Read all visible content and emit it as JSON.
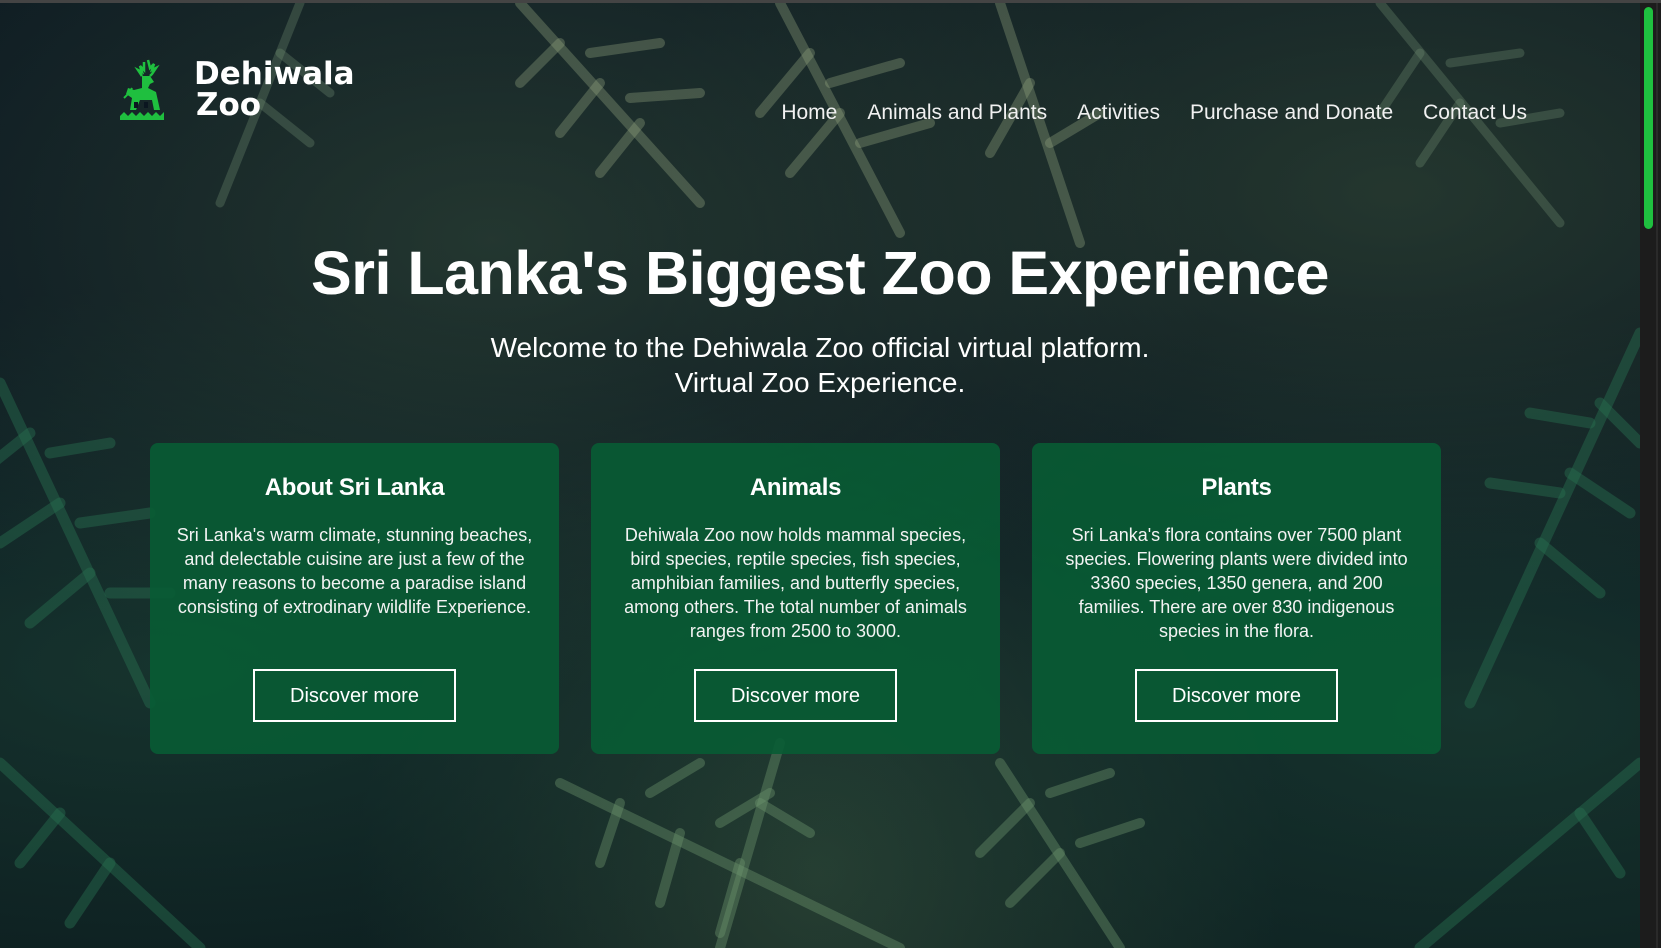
{
  "brand": {
    "name_line1": "Dehiwala",
    "name_line2": "Zoo",
    "logo_icon": "deer-logo-icon",
    "accent_color": "#1fbf3f"
  },
  "nav": {
    "items": [
      {
        "label": "Home"
      },
      {
        "label": "Animals and Plants"
      },
      {
        "label": "Activities"
      },
      {
        "label": "Purchase and Donate"
      },
      {
        "label": "Contact Us"
      }
    ]
  },
  "hero": {
    "title": "Sri Lanka's Biggest Zoo Experience",
    "subtitle_line1": "Welcome to the Dehiwala Zoo official virtual platform.",
    "subtitle_line2": "Virtual Zoo Experience."
  },
  "cards": [
    {
      "title": "About Sri Lanka",
      "text": "Sri Lanka's warm climate, stunning beaches, and delectable cuisine are just a few of the many reasons to become a paradise island consisting of extrodinary wildlife Experience.",
      "button": "Discover more"
    },
    {
      "title": "Animals",
      "text": "Dehiwala Zoo now holds mammal species, bird species, reptile species, fish species, amphibian families, and butterfly species, among others. The total number of animals ranges from 2500 to 3000.",
      "button": "Discover more"
    },
    {
      "title": "Plants",
      "text": "Sri Lanka's flora contains over 7500 plant species. Flowering plants were divided into 3360 species, 1350 genera, and 200 families. There are over 830 indigenous species in the flora.",
      "button": "Discover more"
    }
  ],
  "colors": {
    "card_background": "#085c34",
    "page_background": "#0b1620"
  }
}
